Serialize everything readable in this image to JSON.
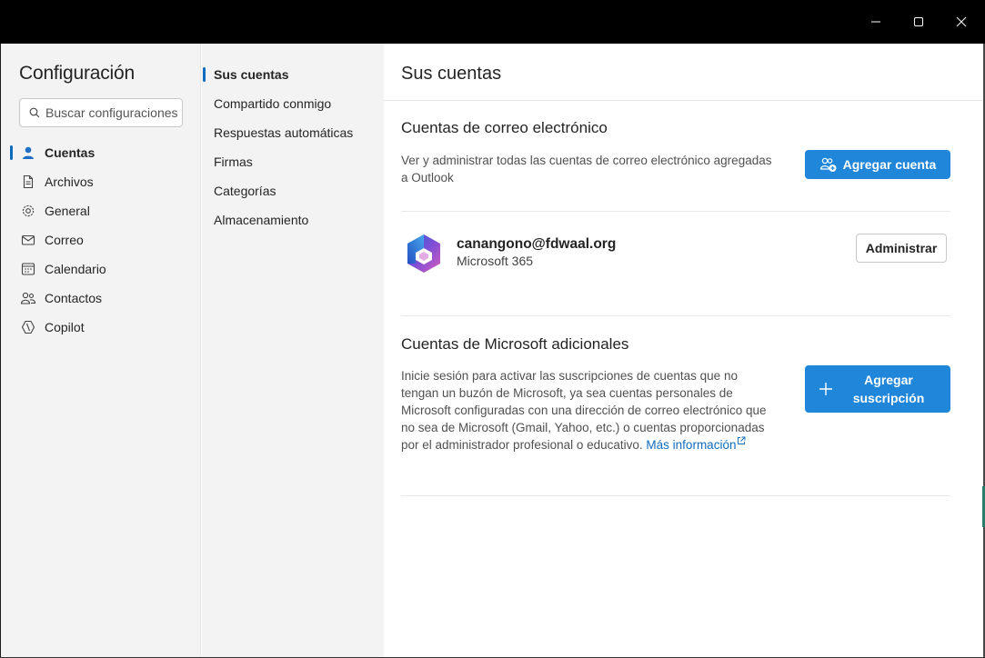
{
  "window": {
    "controls": {
      "minimize_icon": "minimize-icon",
      "maximize_icon": "maximize-icon",
      "close_icon": "close-icon"
    }
  },
  "nav": {
    "title": "Configuración",
    "search_placeholder": "Buscar configuraciones",
    "items": [
      {
        "label": "Cuentas",
        "icon": "person-icon",
        "selected": true
      },
      {
        "label": "Archivos",
        "icon": "document-icon",
        "selected": false
      },
      {
        "label": "General",
        "icon": "gear-icon",
        "selected": false
      },
      {
        "label": "Correo",
        "icon": "mail-icon",
        "selected": false
      },
      {
        "label": "Calendario",
        "icon": "calendar-icon",
        "selected": false
      },
      {
        "label": "Contactos",
        "icon": "people-icon",
        "selected": false
      },
      {
        "label": "Copilot",
        "icon": "copilot-icon",
        "selected": false
      }
    ]
  },
  "subnav": {
    "items": [
      {
        "label": "Sus cuentas",
        "selected": true
      },
      {
        "label": "Compartido conmigo",
        "selected": false
      },
      {
        "label": "Respuestas automáticas",
        "selected": false
      },
      {
        "label": "Firmas",
        "selected": false
      },
      {
        "label": "Categorías",
        "selected": false
      },
      {
        "label": "Almacenamiento",
        "selected": false
      }
    ]
  },
  "content": {
    "header": "Sus cuentas",
    "email_accounts": {
      "title": "Cuentas de correo electrónico",
      "description": "Ver y administrar todas las cuentas de correo electrónico agregadas a Outlook",
      "add_button": "Agregar cuenta"
    },
    "account": {
      "email": "canangono@fdwaal.org",
      "type": "Microsoft 365",
      "manage_button": "Administrar"
    },
    "ms_accounts": {
      "title": "Cuentas de Microsoft adicionales",
      "description": "Inicie sesión para activar las suscripciones de cuentas que no tengan un buzón de Microsoft, ya sea cuentas personales de Microsoft configuradas con una dirección de correo electrónico que no sea de Microsoft (Gmail, Yahoo, etc.) o cuentas proporcionadas por el administrador profesional o educativo.",
      "link_text": "Más información",
      "add_button_line1": "Agregar",
      "add_button_line2": "suscripción"
    }
  },
  "colors": {
    "accent": "#1f86d9",
    "link": "#0f6cbd",
    "selected_indicator": "#0f6cbd"
  }
}
